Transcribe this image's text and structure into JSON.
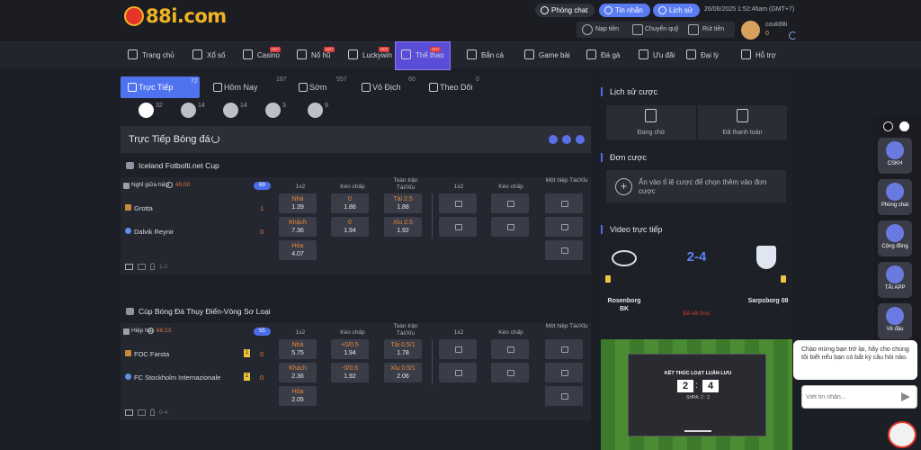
{
  "brand": {
    "logo_text": "88i.com"
  },
  "top": {
    "chat_room": "Phòng chat",
    "messages": "Tin nhắn",
    "history": "Lịch sử",
    "datetime": "26/06/2025 1:52:46am",
    "timezone": "(GMT+7)",
    "deposit": "Nạp tiền",
    "transfer": "Chuyển quỹ",
    "withdraw": "Rút tiền",
    "username": "couk88i",
    "balance": "0"
  },
  "nav": [
    {
      "label": "Trang chủ",
      "hot": false,
      "icon": "home-icon"
    },
    {
      "label": "Xổ số",
      "hot": false,
      "icon": "lottery-icon"
    },
    {
      "label": "Casino",
      "hot": true,
      "icon": "casino-icon"
    },
    {
      "label": "Nổ hũ",
      "hot": true,
      "icon": "slot-icon"
    },
    {
      "label": "Luckywin",
      "hot": true,
      "icon": "luckywin-icon"
    },
    {
      "label": "Thể thao",
      "hot": true,
      "icon": "sports-icon",
      "active": true
    },
    {
      "label": "Bắn cá",
      "hot": false,
      "icon": "fish-icon"
    },
    {
      "label": "Game bài",
      "hot": false,
      "icon": "cards-icon"
    },
    {
      "label": "Đá gà",
      "hot": false,
      "icon": "rooster-icon"
    },
    {
      "label": "Ưu đãi",
      "hot": false,
      "icon": "gift-icon"
    },
    {
      "label": "Đại lý",
      "hot": false,
      "icon": "agent-icon"
    },
    {
      "label": "Hỗ trợ",
      "hot": false,
      "icon": "support-icon"
    }
  ],
  "hot_badge": "HOT",
  "tabs": [
    {
      "label": "Trực Tiếp",
      "count": "72"
    },
    {
      "label": "Hôm Nay",
      "count": "187"
    },
    {
      "label": "Sớm",
      "count": "557"
    },
    {
      "label": "Vô Địch",
      "count": "60"
    },
    {
      "label": "Theo Dõi",
      "count": "0"
    }
  ],
  "sports": [
    {
      "icon": "soccer-icon",
      "count": "32"
    },
    {
      "icon": "basketball-icon",
      "count": "14"
    },
    {
      "icon": "tennis-icon",
      "count": "14"
    },
    {
      "icon": "volleyball-icon",
      "count": "3"
    },
    {
      "icon": "badminton-icon",
      "count": "9"
    }
  ],
  "section_title": "Trực Tiếp Bóng đá",
  "col_headers": {
    "h1x2": "1x2",
    "hcap": "Kèo chấp",
    "ou_full": "Toàn trận Tài/Xỉu",
    "half": "Một hiệp Tài/Xỉu"
  },
  "matches": [
    {
      "league": "Iceland Fotbolti.net Cup",
      "status": "Nghỉ giữa hiệp",
      "time": "45:00",
      "more": "69",
      "home": "Grotta",
      "away": "Dalvik Reynir",
      "home_score": "1",
      "away_score": "0",
      "home_card": "",
      "away_card": "",
      "x12": [
        {
          "t": "Nhà",
          "o": "1.39"
        },
        {
          "t": "Khách",
          "o": "7.36"
        },
        {
          "t": "Hòa",
          "o": "4.07"
        }
      ],
      "hcap": [
        {
          "t": "0",
          "o": "1.88"
        },
        {
          "t": "0",
          "o": "1.94"
        }
      ],
      "ou": [
        {
          "t": "Tài 2.5",
          "o": "1.88"
        },
        {
          "t": "Xỉu 2.5",
          "o": "1.92"
        }
      ],
      "footer": "1-2"
    },
    {
      "league": "Cúp Bóng Đá Thụy Điển-Vòng Sơ Loại",
      "status": "Hiệp hai",
      "time": "66:23",
      "more": "55",
      "home": "FOC Farsta",
      "away": "FC Stockholm Internazionale",
      "home_score": "0",
      "away_score": "0",
      "home_card": "1",
      "away_card": "1",
      "x12": [
        {
          "t": "Nhà",
          "o": "5.75"
        },
        {
          "t": "Khách",
          "o": "2.36"
        },
        {
          "t": "Hòa",
          "o": "2.05"
        }
      ],
      "hcap": [
        {
          "t": "+0/0.5",
          "o": "1.94"
        },
        {
          "t": "-0/0.5",
          "o": "1.92"
        }
      ],
      "ou": [
        {
          "t": "Tài 0.5/1",
          "o": "1.78"
        },
        {
          "t": "Xỉu 0.5/1",
          "o": "2.06"
        }
      ],
      "footer": "0-4"
    }
  ],
  "side": {
    "history_title": "Lịch sử cược",
    "pending": "Đang chờ",
    "settled": "Đã thanh toán",
    "slip_title": "Đơn cược",
    "slip_hint": "Ấn vào tỉ lệ cược để chọn thêm vào đơn cược",
    "video_title": "Video trực tiếp",
    "team_a": "Rosenborg BK",
    "team_b": "Sarpsborg 08",
    "score": "2-4",
    "video_status": "Đã kết thúc",
    "screen_title": "KẾT THÚC LOẠT LUÂN LƯU",
    "screen_a": "2",
    "screen_b": "4",
    "screen_sub": "SHPA: 2 : 2"
  },
  "rail": [
    {
      "label": "CSKH"
    },
    {
      "label": "Phòng chat"
    },
    {
      "label": "Cộng đồng"
    },
    {
      "label": "TẢI APP"
    },
    {
      "label": "Về đầu"
    }
  ],
  "chat": {
    "message": "Chào mừng bạn trở lại, hãy cho chúng tôi biết nếu bạn có bất kỳ câu hỏi nào.",
    "placeholder": "Viết tin nhắn..."
  },
  "colors": {
    "accent": "#4c6cf0",
    "odds_label": "#e8873a",
    "bg": "#1d1f26"
  }
}
